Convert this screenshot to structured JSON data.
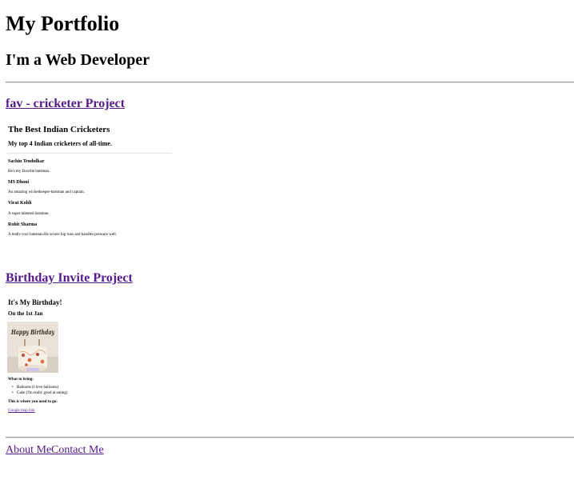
{
  "header": {
    "title": "My Portfolio",
    "subtitle": "I'm a Web Developer"
  },
  "projects": [
    {
      "link_label": "fav - cricketer Project",
      "embed": {
        "heading": "The Best Indian Cricketers",
        "subheading": "My top 4 Indian cricketers of all-time.",
        "players": [
          {
            "name": "Sachin Tendulkar",
            "desc": "He's my favorite batsman."
          },
          {
            "name": "MS Dhoni",
            "desc": "An amazing wicketkeeper-batsman and captain."
          },
          {
            "name": "Virat Kohli",
            "desc": "A super talented batsman."
          },
          {
            "name": "Rohit Sharma",
            "desc": "A really cool batsman.He scores big runs and handles pressure well."
          }
        ]
      }
    },
    {
      "link_label": "Birthday Invite Project",
      "embed": {
        "heading": "It's My Birthday!",
        "date": "On the 1st Jan",
        "cake_text": "Happy Birthday",
        "bring_label": "What to bring:",
        "bring_items": [
          "Balloons (I love balloons)",
          "Cake (I'm really good at eating)"
        ],
        "where_label": "This is where you need to go:",
        "map_link": "Google map link"
      }
    }
  ],
  "footer": {
    "links": [
      "About Me",
      "Contact Me"
    ]
  },
  "colors": {
    "visited_link": "#551a8b",
    "rule": "#9a9a9a"
  }
}
